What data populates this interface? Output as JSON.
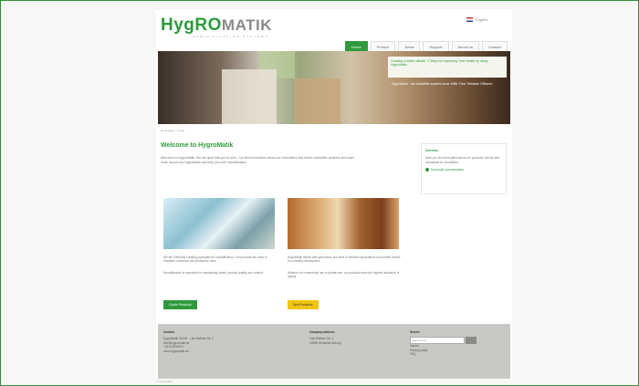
{
  "logo": {
    "brand_a": "HygRO",
    "brand_b": "MATIK",
    "tagline": "HUMIDIFICATION SYSTEMS"
  },
  "lang": {
    "label": "English"
  },
  "nav": [
    "Home",
    "Product",
    "News",
    "Support",
    "About Us",
    "Contact"
  ],
  "hero": {
    "card_text": "Creating a better climate. 3 Steps for improving Your Health by using HygroMatik.",
    "body_text": "HygroMatik - the humidifier experts since 1986. Fast. Reliable. Efficient."
  },
  "breadcrumb": "Homepage > Home",
  "welcome": {
    "title": "Welcome to HygroMatik",
    "text": "Welcome to HygroMatik. We are glad that you're here. You find information about our humidifiers and steam humidifier systems and learn more about how HygroMatik can help you with humidification."
  },
  "sidebox": {
    "title": "Service",
    "text": "Here you find information about our products, service and downloads for humidifiers.",
    "link": "Download documentation"
  },
  "columns": {
    "left": {
      "p1": "We are Germany's leading specialist for humidification. Our products are used in hospitals, museums and production sites.",
      "p2": "Humidification is important for maintaining health, product quality and comfort.",
      "button": "Guide Products"
    },
    "right": {
      "p1": "HygroMatik steam bath generators are used in wellness applications and private homes for a healthy atmosphere.",
      "p2": "Whether for commercial use or private use, our products meet the highest standards of quality.",
      "button": "Spa Products"
    }
  },
  "footer": {
    "col1": {
      "heading": "Contact",
      "lines": [
        "HygroMatik GmbH · Lise-Meitner-Str. 3",
        "info@hygromatik.de",
        "+49 4193 895-0",
        "www.hygromatik.de"
      ]
    },
    "col2": {
      "heading": "Company address",
      "lines": [
        "Lise-Meitner-Str. 3",
        "24558 Henstedt-Ulzburg"
      ]
    },
    "col3": {
      "heading": "Search",
      "placeholder": "Search term",
      "links": [
        "Imprint",
        "Privacy policy",
        "FAQ"
      ]
    }
  },
  "bottom": "© HygroMatik"
}
